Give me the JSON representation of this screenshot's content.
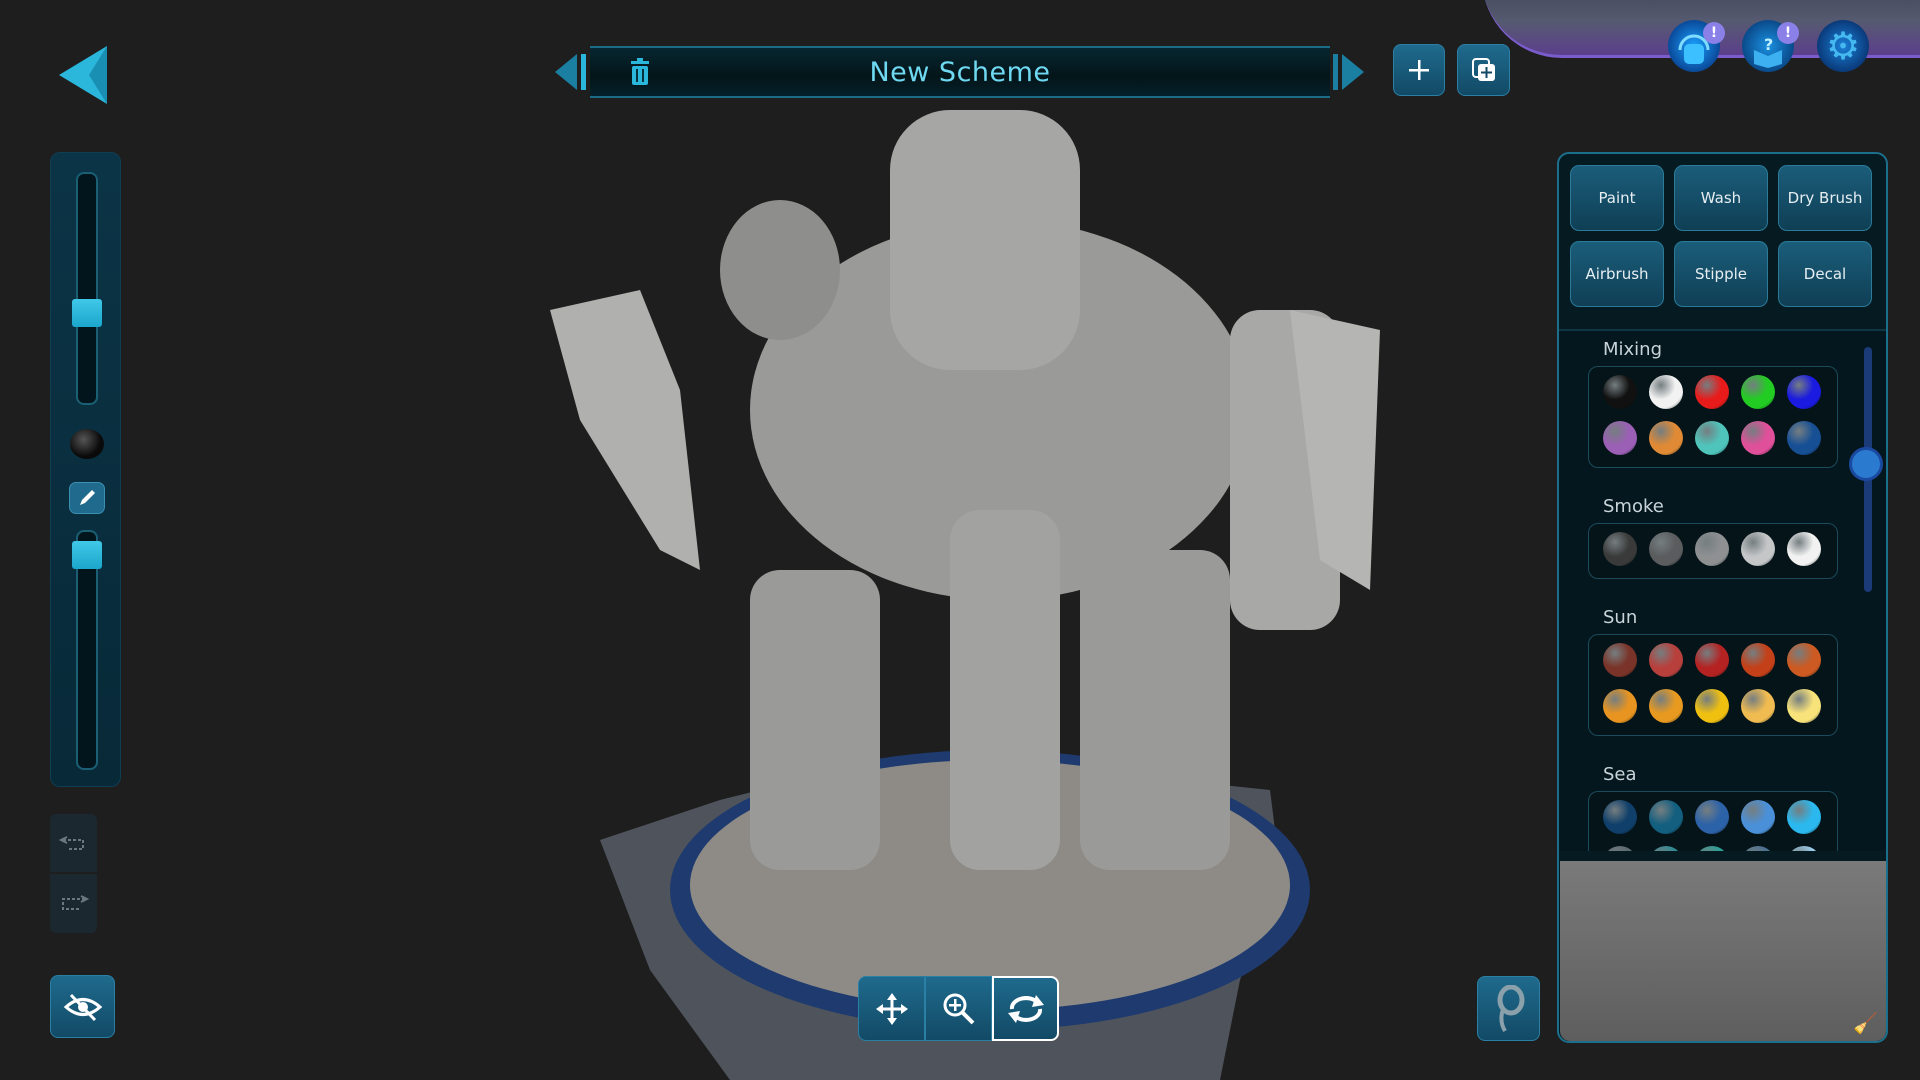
{
  "header": {
    "title": "New Scheme",
    "icons": [
      "back-arrow-icon",
      "prev-scheme-icon",
      "trash-icon",
      "next-scheme-icon",
      "plus-icon",
      "duplicate-icon"
    ]
  },
  "top_right": {
    "icons": [
      "support-headset-icon",
      "help-book-icon",
      "settings-gear-icon"
    ],
    "badges": [
      "!",
      "!"
    ]
  },
  "modes": [
    "Paint",
    "Wash",
    "Dry Brush",
    "Airbrush",
    "Stipple",
    "Decal"
  ],
  "palette": {
    "groups": [
      {
        "name": "Mixing",
        "colors": [
          "#111111",
          "#f2f2f2",
          "#e81b1b",
          "#22cc22",
          "#1a1ae0",
          "#9b5fb5",
          "#e08a35",
          "#4fc4bb",
          "#e04f9a",
          "#174f95"
        ]
      },
      {
        "name": "Smoke",
        "colors": [
          "#3a3a3a",
          "#5a5c5e",
          "#8e9092",
          "#c4c6c8",
          "#f2f2f2"
        ]
      },
      {
        "name": "Sun",
        "colors": [
          "#7a3328",
          "#b8403c",
          "#b52222",
          "#c44018",
          "#cc5a22",
          "#e89420",
          "#e89a20",
          "#f0c010",
          "#f0bb50",
          "#f8e27a"
        ]
      },
      {
        "name": "Sea",
        "colors": [
          "#0f3f6a",
          "#135f80",
          "#2c62a8",
          "#4a90d8",
          "#2ab8ee",
          "#5c6a70",
          "#2f8a94",
          "#2aa094",
          "#4a7090",
          "#9acbe8"
        ]
      }
    ]
  },
  "left_tools": {
    "brush_size_level": 0.38,
    "opacity_level": 0.95,
    "current_color": "#111111"
  },
  "bottom_tools": [
    "move-icon",
    "zoom-icon",
    "rotate-icon"
  ],
  "active_bottom_tool": "rotate-icon",
  "accent": "#2bb6dc"
}
